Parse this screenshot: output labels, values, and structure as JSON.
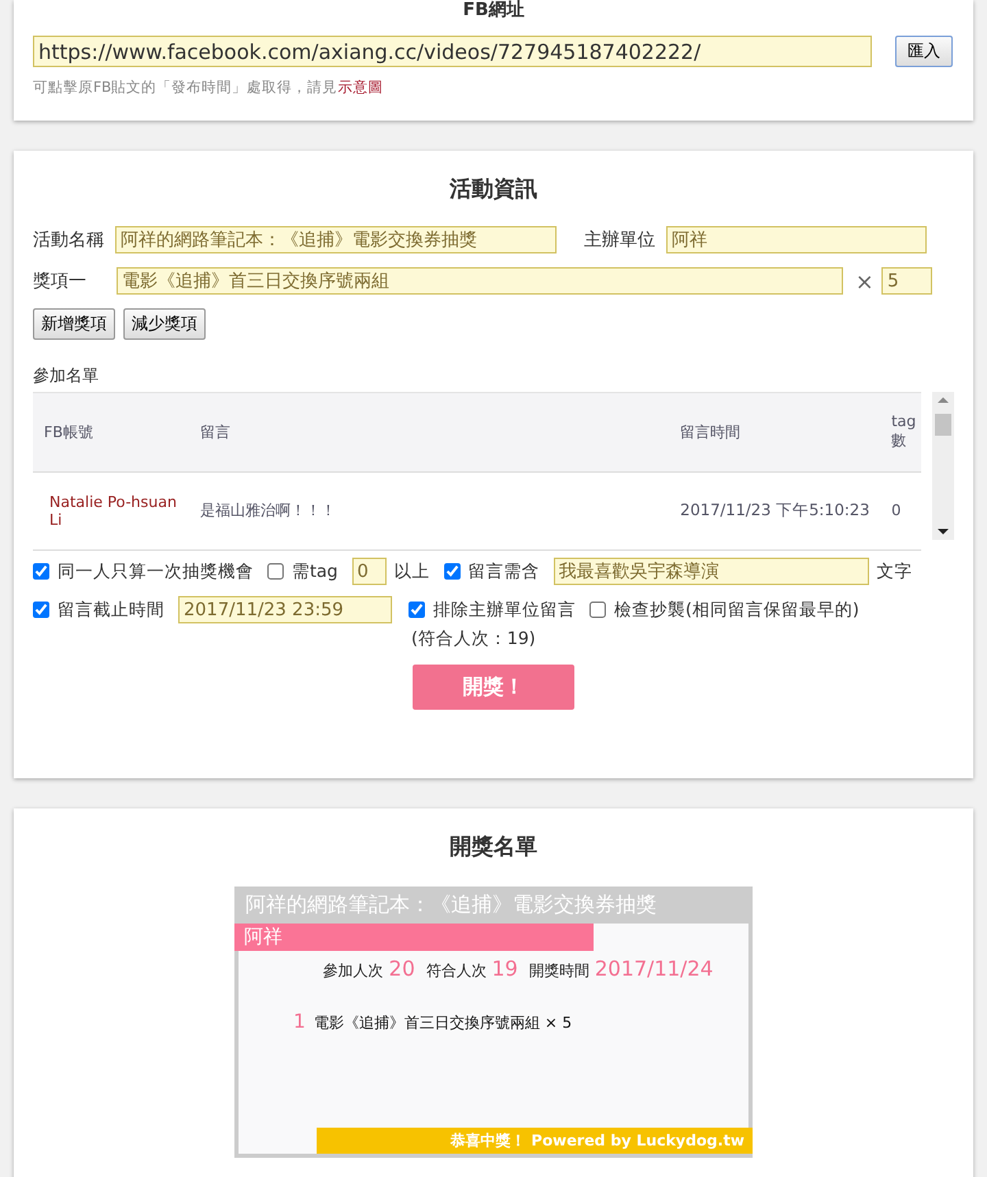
{
  "url_section": {
    "title": "FB網址",
    "url": "https://www.facebook.com/axiang.cc/videos/727945187402222/",
    "import_button": "匯入",
    "hint": "可點擊原FB貼文的「發布時間」處取得，請見",
    "hint_link": "示意圖"
  },
  "activity": {
    "title": "活動資訊",
    "fields": [
      {
        "label": "活動名稱",
        "value": "阿祥的網路筆記本：《追捕》電影交換券抽獎"
      },
      {
        "label": "主辦單位",
        "value": "阿祥"
      }
    ],
    "prizes": [
      {
        "label": "獎項一",
        "value": "電影《追捕》首三日交換序號兩組",
        "times": "×",
        "count": "5"
      }
    ],
    "buttons": [
      "新增獎項",
      "減少獎項"
    ],
    "list_label": "參加名單",
    "columns": [
      "FB帳號",
      "留言",
      "留言時間",
      "tag數"
    ],
    "rows": [
      {
        "account": "Natalie Po-hsuan Li",
        "comment": "是福山雅治啊！！！",
        "time": "2017/11/23 下午5:10:23",
        "tags": "0"
      }
    ],
    "options": [
      [
        {
          "kind": "checkbox",
          "label": "同一人只算一次抽獎機會",
          "checked": true
        },
        {
          "kind": "checkbox",
          "label": "需tag",
          "checked": false
        },
        {
          "kind": "input",
          "value": "0"
        },
        {
          "kind": "text",
          "text": "以上"
        },
        {
          "kind": "checkbox",
          "label": "留言需含",
          "checked": true
        },
        {
          "kind": "input",
          "value": "我最喜歡吳宇森導演"
        },
        {
          "kind": "text",
          "text": "文字"
        }
      ],
      [
        {
          "kind": "checkbox",
          "label": "留言截止時間",
          "checked": true
        },
        {
          "kind": "input",
          "value": "2017/11/23 23:59"
        },
        {
          "kind": "checkbox",
          "label": "排除主辦單位留言",
          "checked": true
        },
        {
          "kind": "checkbox",
          "label": "檢查抄襲(相同留言保留最早的)",
          "checked": false
        }
      ]
    ],
    "count_note": "(符合人次：19)",
    "draw_button": "開獎！"
  },
  "results": {
    "title": "開獎名單",
    "board": {
      "heading": "阿祥的網路筆記本：《追捕》電影交換券抽獎",
      "organizer": "阿祥",
      "stats": [
        {
          "label": "參加人次",
          "value": "20"
        },
        {
          "label": "符合人次",
          "value": "19"
        },
        {
          "label": "開獎時間",
          "value": "2017/11/24"
        }
      ],
      "prizes": [
        {
          "number": "1",
          "text": "電影《追捕》首三日交換序號兩組 × 5"
        }
      ],
      "footer": "恭喜中獎！ Powered by Luckydog.tw"
    }
  }
}
